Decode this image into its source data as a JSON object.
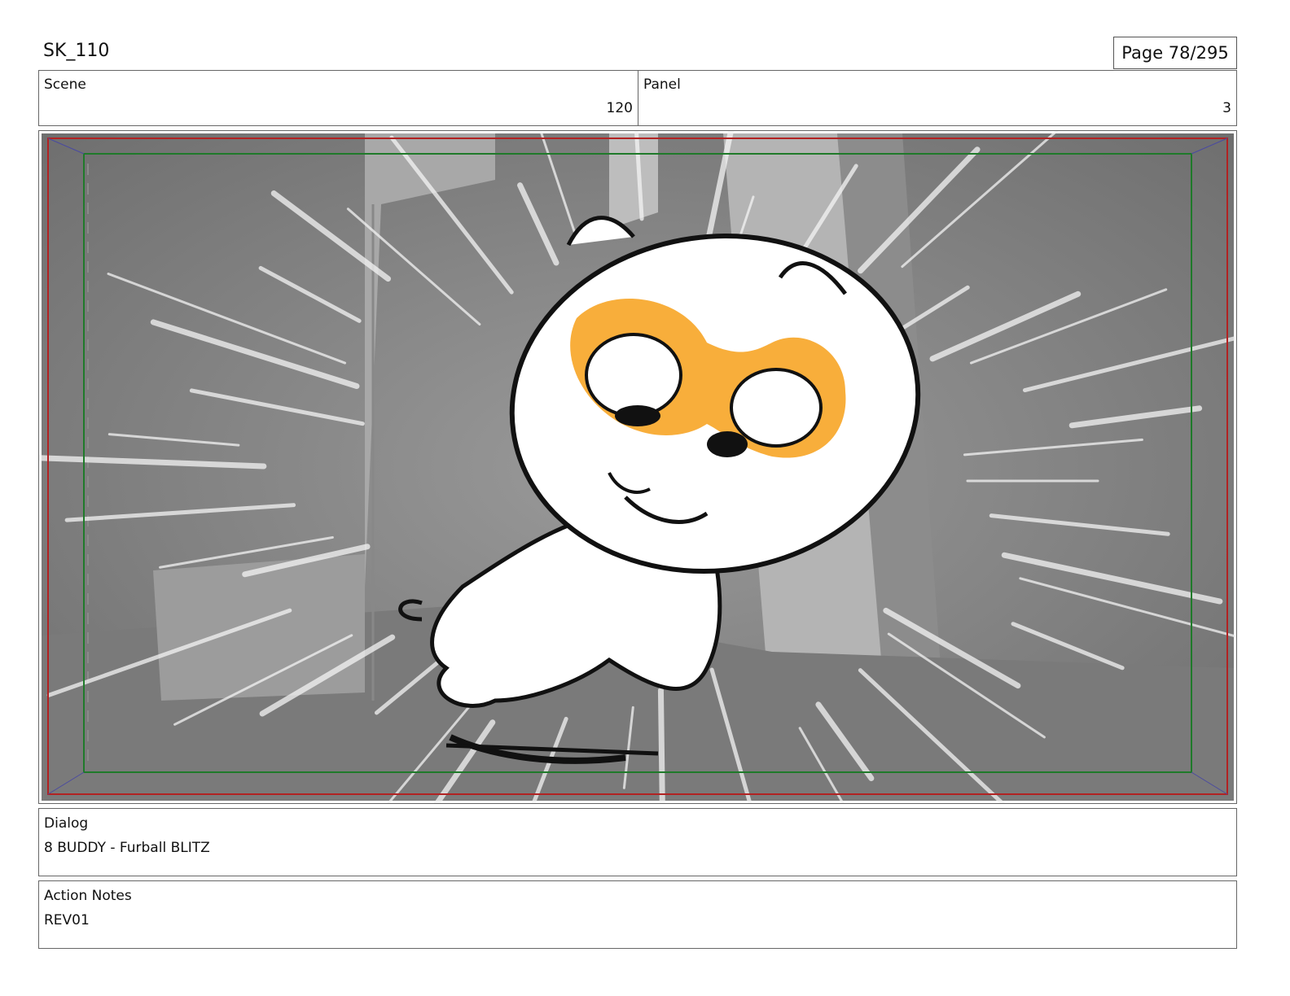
{
  "header": {
    "sequence": "SK_110",
    "page": "Page  78/295"
  },
  "scene": {
    "label": "Scene",
    "value": "120"
  },
  "panel": {
    "label": "Panel",
    "value": "3"
  },
  "panel_image": {
    "character_mask_color": "#f8ae3b",
    "safe_frame_color": "#b22222",
    "title_safe_color": "#1f7a2a"
  },
  "dialog": {
    "label": "Dialog",
    "text": "8 BUDDY - Furball BLITZ"
  },
  "action_notes": {
    "label": "Action Notes",
    "text": "REV01"
  }
}
